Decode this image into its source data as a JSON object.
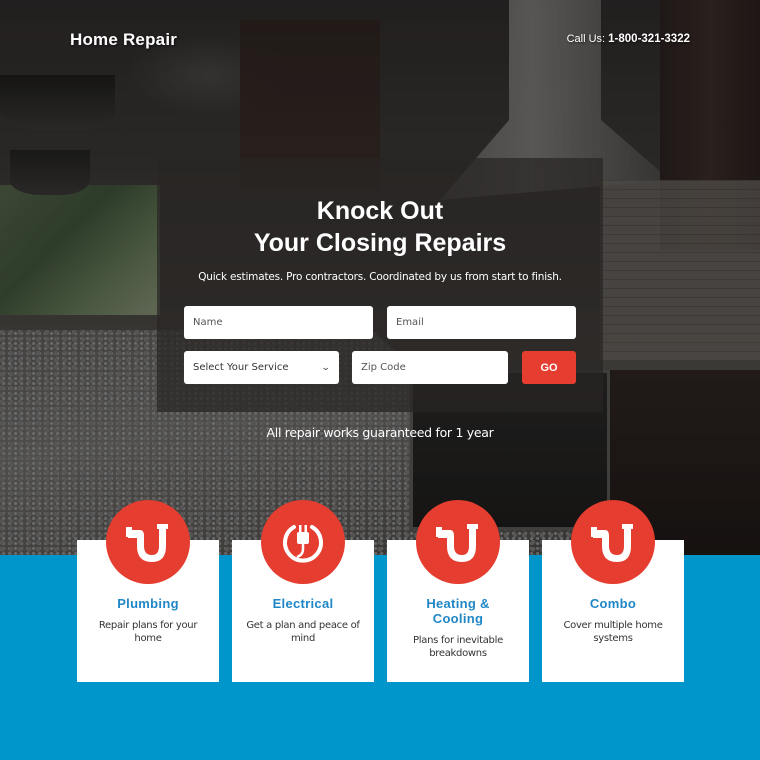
{
  "header": {
    "logo": "Home Repair",
    "call_label": "Call Us:",
    "phone": "1-800-321-3322"
  },
  "hero": {
    "headline_line1": "Knock Out",
    "headline_line2": "Your Closing Repairs",
    "subline": "Quick estimates. Pro contractors. Coordinated by us from start to finish.",
    "guarantee": "All repair works guaranteed for 1 year"
  },
  "form": {
    "name_placeholder": "Name",
    "email_placeholder": "Email",
    "service_selected": "Select Your Service",
    "zip_placeholder": "Zip Code",
    "go_label": "GO"
  },
  "services": [
    {
      "title": "Plumbing",
      "desc": "Repair plans for your home",
      "icon": "pipe-icon"
    },
    {
      "title": "Electrical",
      "desc": "Get a plan and peace of mind",
      "icon": "plug-icon"
    },
    {
      "title": "Heating & Cooling",
      "desc": "Plans for inevitable breakdowns",
      "icon": "pipe-icon"
    },
    {
      "title": "Combo",
      "desc": "Cover multiple home systems",
      "icon": "pipe-icon"
    }
  ],
  "colors": {
    "accent_red": "#e53d2f",
    "brand_blue": "#0096cb",
    "title_blue": "#1f87c6"
  }
}
